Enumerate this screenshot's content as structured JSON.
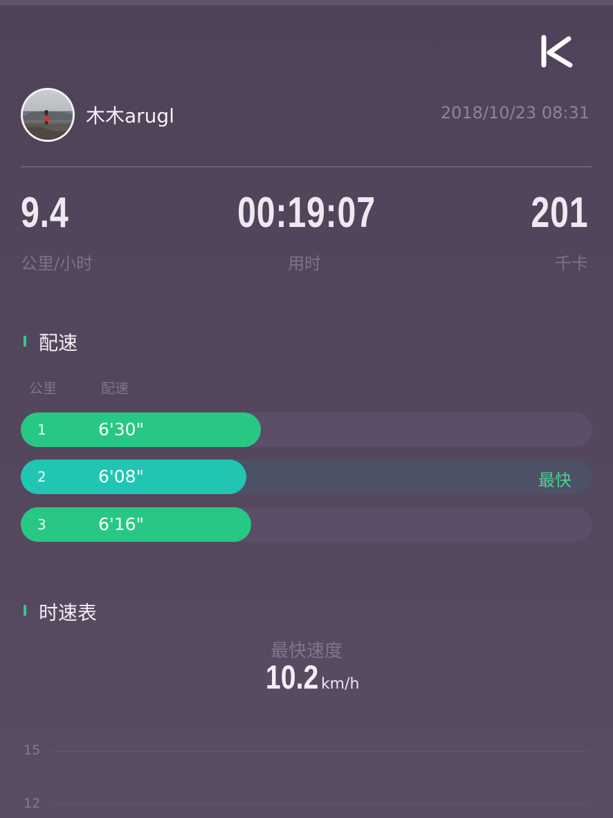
{
  "brand": {
    "logo_icon": "keep-k-logo-icon"
  },
  "profile": {
    "username": "木木arugl",
    "datetime": "2018/10/23 08:31"
  },
  "stats": {
    "speed": {
      "value": "9.4",
      "label": "公里/小时"
    },
    "duration": {
      "value": "00:19:07",
      "label": "用时"
    },
    "calories": {
      "value": "201",
      "label": "千卡"
    }
  },
  "pace_section": {
    "title": "配速",
    "col_km": "公里",
    "col_pace": "配速",
    "fastest_label": "最快",
    "rows": [
      {
        "km": "1",
        "pace": "6'30\"",
        "fill_fraction": 0.42,
        "fastest": false
      },
      {
        "km": "2",
        "pace": "6'08\"",
        "fill_fraction": 0.395,
        "fastest": true
      },
      {
        "km": "3",
        "pace": "6'16\"",
        "fill_fraction": 0.403,
        "fastest": false
      }
    ]
  },
  "speed_section": {
    "title": "时速表",
    "fastest_label": "最快速度",
    "fastest_value": "10.2",
    "unit": "km/h",
    "y_ticks": [
      "15",
      "12"
    ]
  },
  "colors": {
    "background": "#54475d",
    "accent_green": "#27c883",
    "accent_teal": "#21c6b2",
    "muted_text": "#7d7388"
  }
}
